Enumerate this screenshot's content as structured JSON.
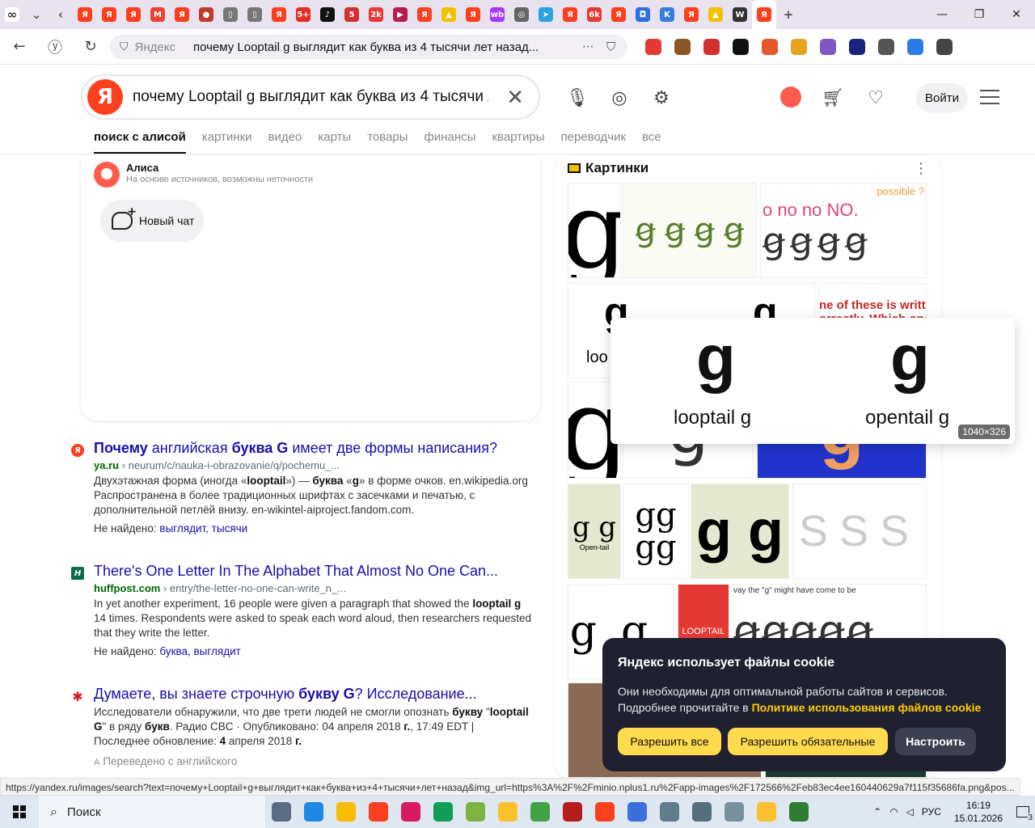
{
  "browser": {
    "tabs": [
      {
        "icon": "infinity-icon",
        "color": "#333333",
        "glyph": "∞"
      },
      {
        "icon": "chevron-down-icon",
        "color": "#555555",
        "glyph": "⌄"
      },
      {
        "icon": "back-tab-icon",
        "color": "#555555",
        "glyph": "‹"
      },
      {
        "icon": "yandex-icon",
        "color": "#fc3f1d",
        "glyph": "Я"
      },
      {
        "icon": "yandex-icon",
        "color": "#fc3f1d",
        "glyph": "Я"
      },
      {
        "icon": "yandex-icon",
        "color": "#fc3f1d",
        "glyph": "Я"
      },
      {
        "icon": "gmail-icon",
        "color": "#ea4335",
        "glyph": "M"
      },
      {
        "icon": "yandex-icon",
        "color": "#fc3f1d",
        "glyph": "Я"
      },
      {
        "icon": "red-circle-icon",
        "color": "#c0392b",
        "glyph": "●"
      },
      {
        "icon": "document-icon",
        "color": "#777777",
        "glyph": "▯"
      },
      {
        "icon": "document-icon",
        "color": "#777777",
        "glyph": "▯"
      },
      {
        "icon": "yandex-icon",
        "color": "#fc3f1d",
        "glyph": "Я"
      },
      {
        "icon": "five-plus-icon",
        "color": "#e52d27",
        "glyph": "5+"
      },
      {
        "icon": "tiktok-icon",
        "color": "#111111",
        "glyph": "♪"
      },
      {
        "icon": "five-icon",
        "color": "#d32f2f",
        "glyph": "5"
      },
      {
        "icon": "badge-2k-icon",
        "color": "#e53935",
        "glyph": "2k"
      },
      {
        "icon": "play-icon",
        "color": "#b71c4f",
        "glyph": "▶"
      },
      {
        "icon": "yandex-icon",
        "color": "#fc3f1d",
        "glyph": "Я"
      },
      {
        "icon": "pictures-icon",
        "color": "#f2c200",
        "glyph": "▲"
      },
      {
        "icon": "yandex-icon",
        "color": "#fc3f1d",
        "glyph": "Я"
      },
      {
        "icon": "wildberries-icon",
        "color": "#a73afd",
        "glyph": "wb"
      },
      {
        "icon": "dribbble-icon",
        "color": "#666666",
        "glyph": "◎"
      },
      {
        "icon": "telegram-icon",
        "color": "#2aa3e0",
        "glyph": "➤"
      },
      {
        "icon": "yandex-icon",
        "color": "#fc3f1d",
        "glyph": "Я"
      },
      {
        "icon": "badge-6k-icon",
        "color": "#e53935",
        "glyph": "6k"
      },
      {
        "icon": "yandex-icon",
        "color": "#fc3f1d",
        "glyph": "Я"
      },
      {
        "icon": "square-app-icon",
        "color": "#2f6fe4",
        "glyph": "◘"
      },
      {
        "icon": "k-icon",
        "color": "#3b7ddd",
        "glyph": "K"
      },
      {
        "icon": "yandex-icon",
        "color": "#fc3f1d",
        "glyph": "Я"
      },
      {
        "icon": "pictures-icon",
        "color": "#f2c200",
        "glyph": "▲"
      },
      {
        "icon": "wikipedia-icon",
        "color": "#333333",
        "glyph": "W"
      },
      {
        "icon": "yandex-icon",
        "color": "#fc3f1d",
        "glyph": "Я",
        "active": true
      },
      {
        "icon": "new-tab-icon",
        "color": "#555555",
        "glyph": "+"
      }
    ],
    "window_controls": [
      "—",
      "❐",
      "✕"
    ],
    "address": {
      "site": "Яндекс",
      "url_text": "почему Looptail g выглядит как буква из 4 тысячи лет назад...",
      "more": "···"
    },
    "extensions": [
      "#e53935",
      "#8d5524",
      "#d32f2f",
      "#111111",
      "#e8572a",
      "#e6a31e",
      "#7e57c2",
      "#1a237e",
      "#555555",
      "#2a7be4",
      "#444444"
    ],
    "status_url": "https://yandex.ru/images/search?text=почему+Looptail+g+выглядит+как+буква+из+4+тысячи+лет+назад&img_url=https%3A%2F%2Fminio.nplus1.ru%2Fapp-images%2F172566%2Feb83ec4ee160440629a7f115f35686fa.png&pos..."
  },
  "header": {
    "logo": "Я",
    "query": "почему Looptail g выглядит как буква из 4 тысячи лет назад",
    "login": "Войти",
    "services": [
      "поиск с алисой",
      "картинки",
      "видео",
      "карты",
      "товары",
      "финансы",
      "квартиры",
      "переводчик",
      "все"
    ],
    "active_service": 0
  },
  "alice": {
    "name": "Алиса",
    "subtitle": "На основе источников, возможны неточности",
    "new_chat": "Новый чат"
  },
  "results": [
    {
      "favicon": "Я",
      "fav_color": "#fc3f1d",
      "title_html": "<b>Почему</b> английская <b>буква G</b> имеет две формы написания?",
      "domain": "ya.ru",
      "path": "› neurum/c/nauka-i-obrazovanie/q/pochemu_...",
      "snippet_html": "Двухэтажная форма (иногда «<b>looptail</b>») — <b>буква</b> «<b>g</b>» в форме очков. en.wikipedia.org Распространена в более традиционных шрифтах с засечками и печатью, с дополнительной петлёй внизу. en-wikintel-aiproject.fandom.com.",
      "not_found_label": "Не найдено:",
      "not_found_words": "выглядит, тысячи"
    },
    {
      "favicon": "H",
      "fav_color": "#0d6b4f",
      "title_html": "There's One Letter In The Alphabet That Almost No One Can...",
      "domain": "huffpost.com",
      "path": "› entry/the-letter-no-one-can-write_n_...",
      "snippet_html": "In yet another experiment, 16 people were given a paragraph that showed the <b>looptail g</b> 14 times. Respondents were asked to speak each word aloud, then researchers requested that they write the letter.",
      "not_found_label": "Не найдено:",
      "not_found_words": "буква, выглядит"
    },
    {
      "favicon": "✱",
      "fav_color": "#d71920",
      "title_html": "Думаете, вы знаете строчную <b>букву G</b>? Исследование...",
      "domain": "",
      "path": "",
      "snippet_html": "Исследователи обнаружили, что две трети людей не смогли опознать <b>букву</b> \"<b>looptail G</b>\" в ряду <b>букв</b>. Радио CBC · Опубликовано: 04 апреля 2018 <b>г.</b>, 17:49 EDT | Последнее обновление: <b>4</b> апреля 2018 <b>г.</b>",
      "translated": "Переведено с английского"
    }
  ],
  "images": {
    "title": "Картинки",
    "thumb_texts": {
      "no_no": "o no no NO.",
      "possible": "possible ?",
      "one_of_these": "ne of these is writte",
      "correctly": "orrectly. Which one",
      "looptail_small": "loo",
      "open_tail": "Open-tail",
      "way_g": "vay the \"g\" might have come to be",
      "looptail_logo": "LOOPTAIL"
    },
    "preview": {
      "left_glyph": "g",
      "right_glyph": "g",
      "left_label": "looptail g",
      "right_label": "opentail g",
      "size": "1040×326"
    }
  },
  "cookie": {
    "title": "Яндекс использует файлы cookie",
    "text": "Они необходимы для оптимальной работы сайтов и сервисов. Подробнее прочитайте в",
    "link": "Политике использования файлов cookie",
    "btn_all": "Разрешить все",
    "btn_required": "Разрешить обязательные",
    "btn_settings": "Настроить"
  },
  "taskbar": {
    "search": "Поиск",
    "apps": [
      "#5b6b82",
      "#1e88e5",
      "#fbbc05",
      "#fc3f1d",
      "#d81b60",
      "#0f9d58",
      "#7cb342",
      "#fbc02d",
      "#43a047",
      "#b71c1c",
      "#fc3f1d",
      "#3b6fe0",
      "#607d8b",
      "#546e7a",
      "#78909c",
      "#fbc02d",
      "#2e7d32"
    ],
    "language": "РУС",
    "time": "16:19",
    "date": "15.01.2026",
    "notifications": "3"
  }
}
